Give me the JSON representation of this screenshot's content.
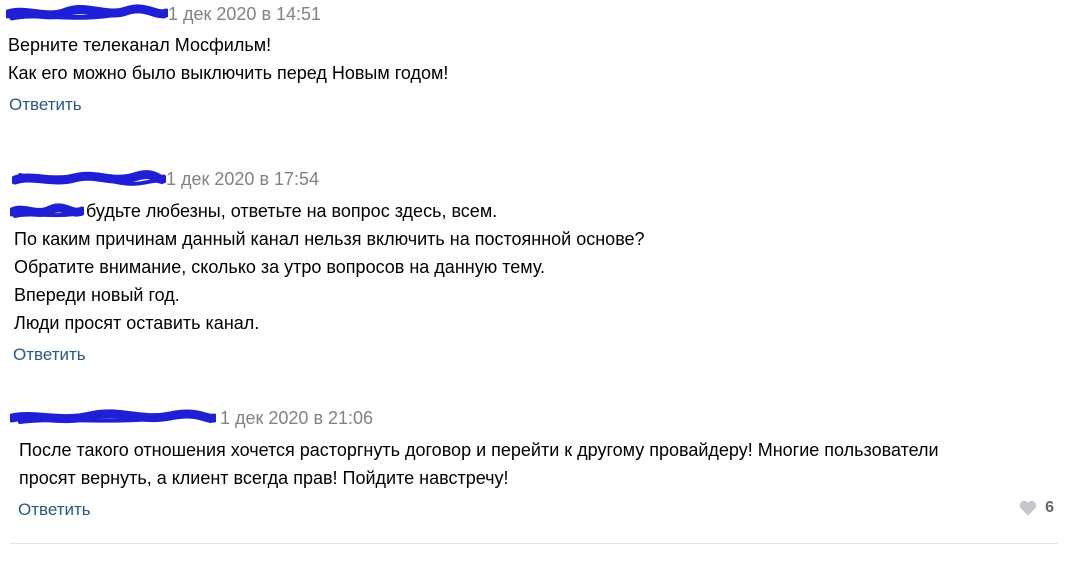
{
  "colors": {
    "link": "#2a5885",
    "date": "#828282",
    "redaction": "#1f1fd6",
    "heart": "#c4c8cc"
  },
  "comments": [
    {
      "date": "1 дек 2020 в 14:51",
      "lines": [
        "Верните телеканал Мосфильм!",
        "Как его можно было выключить перед Новым годом!"
      ],
      "reply_label": "Ответить"
    },
    {
      "date": "1 дек 2020 в 17:54",
      "mention_suffix": "будьте любезны, ответьте на вопрос здесь, всем.",
      "lines": [
        "По каким причинам данный канал нельзя включить на постоянной основе?",
        "Обратите внимание, сколько за утро вопросов на данную тему.",
        "Впереди новый год.",
        "Люди просят оставить канал."
      ],
      "reply_label": "Ответить"
    },
    {
      "date": "1 дек 2020 в 21:06",
      "lines": [
        "После такого отношения хочется расторгнуть договор и перейти к другому провайдеру! Многие пользователи",
        "просят вернуть, а клиент всегда прав! Пойдите навстречу!"
      ],
      "reply_label": "Ответить",
      "likes": "6",
      "like_icon": "heart-icon"
    }
  ]
}
